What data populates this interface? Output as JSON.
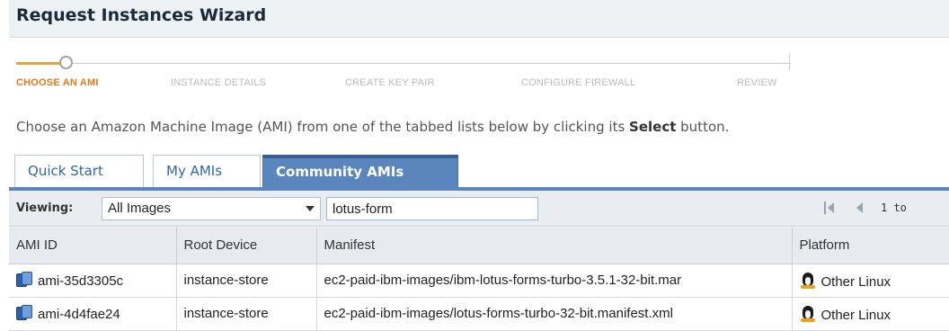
{
  "window": {
    "title": "Request Instances Wizard"
  },
  "wizard": {
    "steps": [
      {
        "label": "CHOOSE AN AMI",
        "active": true
      },
      {
        "label": "INSTANCE DETAILS",
        "active": false
      },
      {
        "label": "CREATE KEY PAIR",
        "active": false
      },
      {
        "label": "CONFIGURE FIREWALL",
        "active": false
      },
      {
        "label": "REVIEW",
        "active": false
      }
    ],
    "accent_color": "#e07a1a"
  },
  "instructions": {
    "prefix": "Choose an Amazon Machine Image (AMI) from one of the tabbed lists below by clicking its ",
    "emphasis": "Select",
    "suffix": " button."
  },
  "tabs": [
    {
      "label": "Quick Start",
      "selected": false
    },
    {
      "label": "My AMIs",
      "selected": false
    },
    {
      "label": "Community AMIs",
      "selected": true
    }
  ],
  "toolbar": {
    "viewing_label": "Viewing:",
    "viewing_selected": "All Images",
    "search_value": "lotus-form",
    "pager_text": "1 to"
  },
  "table": {
    "columns": [
      "AMI ID",
      "Root Device",
      "Manifest",
      "Platform"
    ],
    "rows": [
      {
        "ami_id": "ami-35d3305c",
        "root_device": "instance-store",
        "manifest": "ec2-paid-ibm-images/ibm-lotus-forms-turbo-3.5.1-32-bit.mar",
        "platform": "Other Linux"
      },
      {
        "ami_id": "ami-4d4fae24",
        "root_device": "instance-store",
        "manifest": "ec2-paid-ibm-images/lotus-forms-turbo-32-bit.manifest.xml",
        "platform": "Other Linux"
      }
    ]
  },
  "colors": {
    "tab_selected": "#5b85bd",
    "link_blue": "#2e67a8"
  }
}
